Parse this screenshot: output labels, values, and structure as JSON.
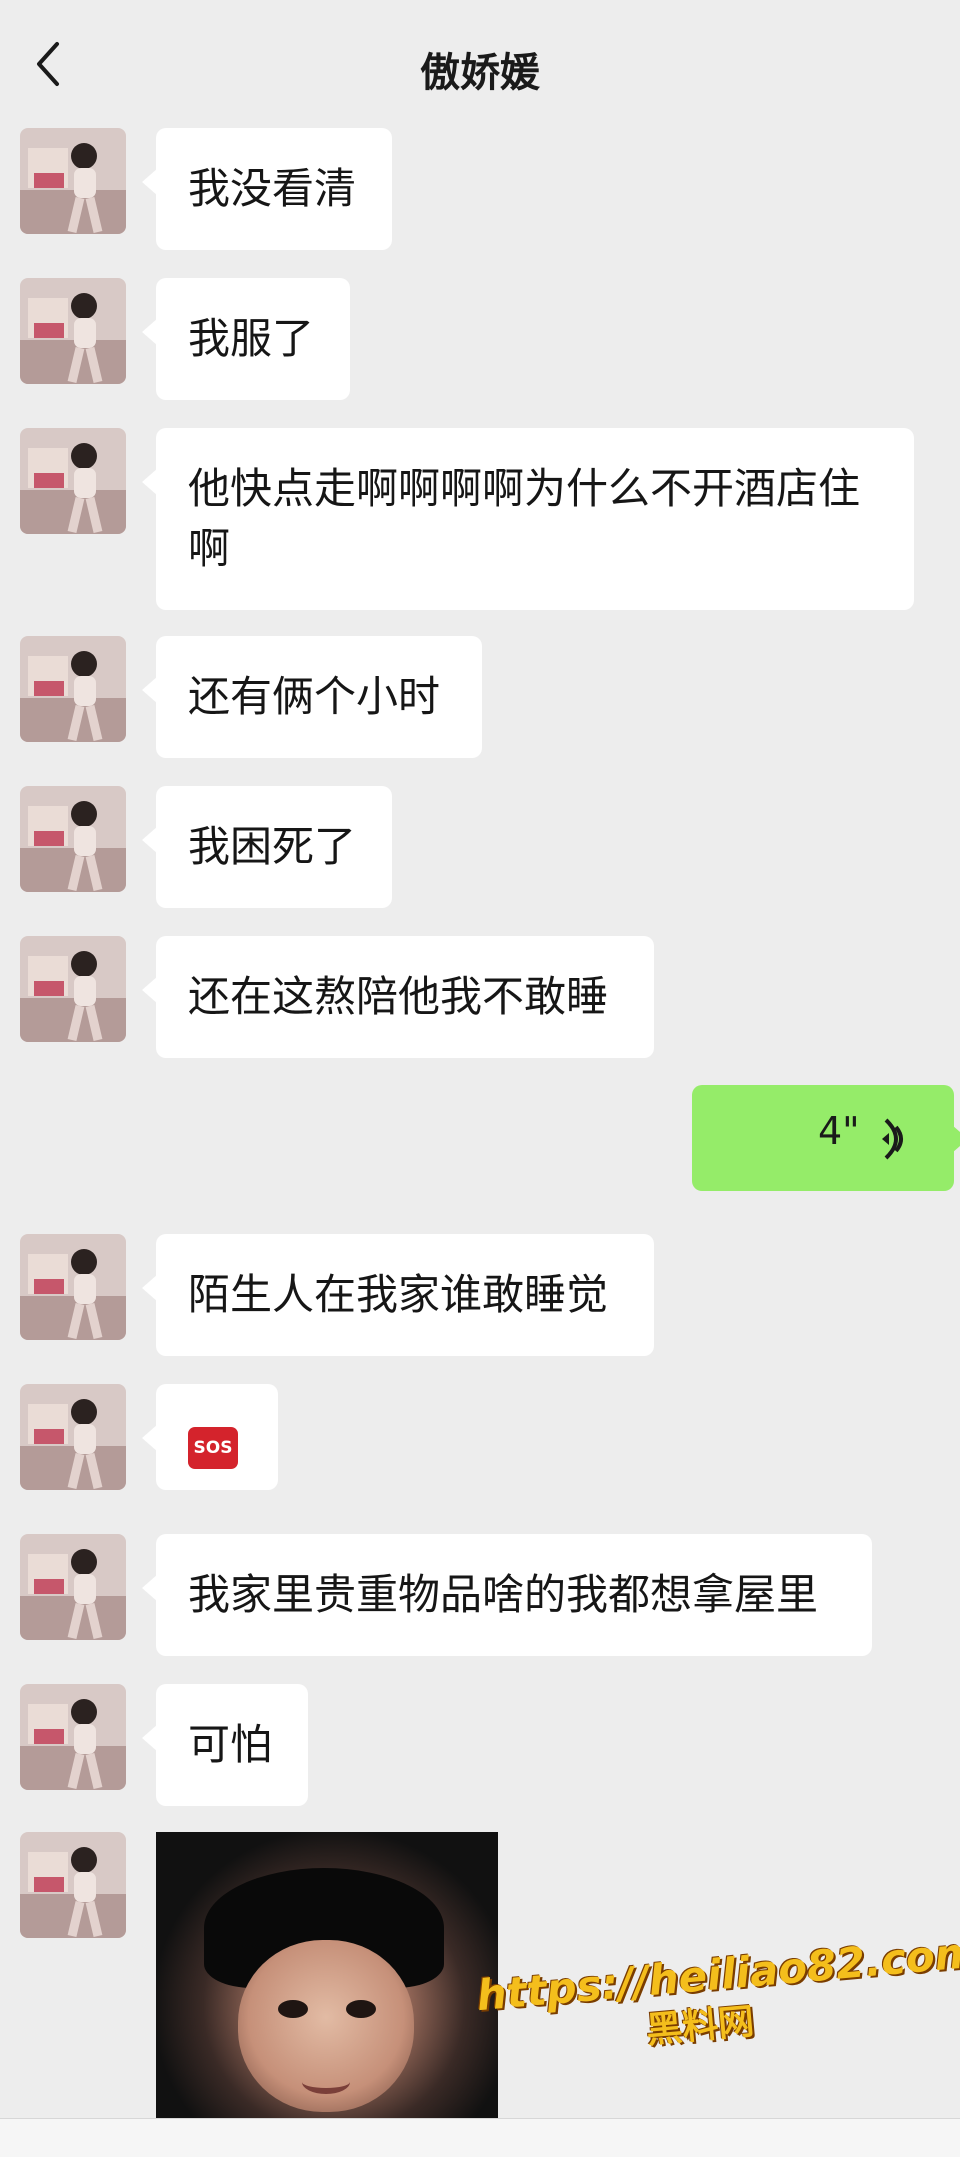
{
  "header": {
    "title": "傲娇媛",
    "back_icon": "chevron-left-icon"
  },
  "messages": [
    {
      "side": "left",
      "type": "text",
      "text": "我没看清"
    },
    {
      "side": "left",
      "type": "text",
      "text": "我服了"
    },
    {
      "side": "left",
      "type": "text",
      "text": "他快点走啊啊啊啊为什么不开酒店住啊"
    },
    {
      "side": "left",
      "type": "text",
      "text": "还有俩个小时"
    },
    {
      "side": "left",
      "type": "text",
      "text": "我困死了"
    },
    {
      "side": "left",
      "type": "text",
      "text": "还在这熬陪他我不敢睡"
    },
    {
      "side": "right",
      "type": "voice",
      "duration": "4\""
    },
    {
      "side": "left",
      "type": "text",
      "text": "陌生人在我家谁敢睡觉"
    },
    {
      "side": "left",
      "type": "emoji",
      "emoji": "SOS",
      "icon": "sos-icon"
    },
    {
      "side": "left",
      "type": "text",
      "text": "我家里贵重物品啥的我都想拿屋里"
    },
    {
      "side": "left",
      "type": "text",
      "text": "可怕"
    },
    {
      "side": "left",
      "type": "image",
      "image": "toddler-face-photo"
    }
  ],
  "watermark": {
    "url": "https://heiliao82.com",
    "name": "黑料网"
  },
  "colors": {
    "background": "#ededed",
    "incoming_bubble": "#ffffff",
    "outgoing_bubble": "#95ec69"
  }
}
